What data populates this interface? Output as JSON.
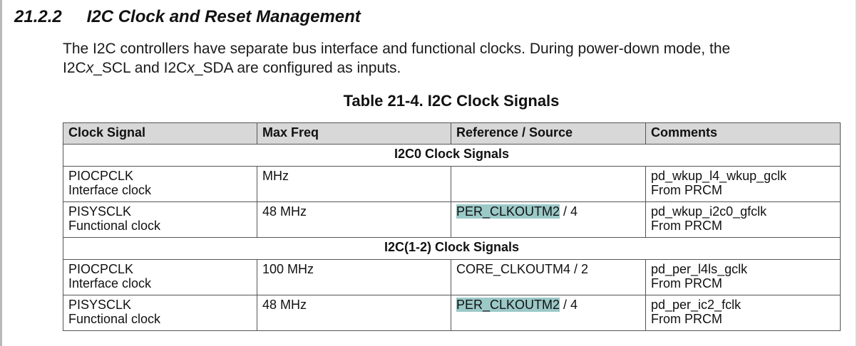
{
  "section": {
    "number": "21.2.2",
    "title": "I2C Clock and Reset Management"
  },
  "paragraph": {
    "part1": "The I2C controllers have separate bus interface and functional clocks. During power-down mode, the",
    "part2_prefix": "I2C",
    "var1": "x",
    "part2_mid": "_SCL and I2C",
    "var2": "x",
    "part2_suffix": "_SDA are configured as inputs."
  },
  "table": {
    "title": "Table 21-4. I2C Clock Signals",
    "headers": [
      "Clock Signal",
      "Max Freq",
      "Reference / Source",
      "Comments"
    ],
    "groups": [
      {
        "label": "I2C0 Clock Signals",
        "rows": [
          {
            "signal": "PIOCPCLK",
            "signal_desc": "Interface clock",
            "freq": "MHz",
            "source_link": "",
            "source_text": "",
            "comment1": "pd_wkup_l4_wkup_gclk",
            "comment2": "From PRCM"
          },
          {
            "signal": "PISYSCLK",
            "signal_desc": "Functional clock",
            "freq": "48 MHz",
            "source_link": "PER_CLKOUTM2",
            "source_text": " / 4",
            "comment1": "pd_wkup_i2c0_gfclk",
            "comment2": "From PRCM"
          }
        ]
      },
      {
        "label": "I2C(1-2) Clock Signals",
        "rows": [
          {
            "signal": "PIOCPCLK",
            "signal_desc": "Interface clock",
            "freq": "100 MHz",
            "source_link": "",
            "source_text": "CORE_CLKOUTM4 / 2",
            "comment1": "pd_per_l4ls_gclk",
            "comment2": "From PRCM"
          },
          {
            "signal": "PISYSCLK",
            "signal_desc": "Functional clock",
            "freq": "48 MHz",
            "source_link": "PER_CLKOUTM2",
            "source_text": " / 4",
            "comment1": "pd_per_ic2_fclk",
            "comment2": "From PRCM"
          }
        ]
      }
    ]
  },
  "colors": {
    "header_background": "#d8d8d8",
    "link_highlight": "#9bc9c8"
  }
}
